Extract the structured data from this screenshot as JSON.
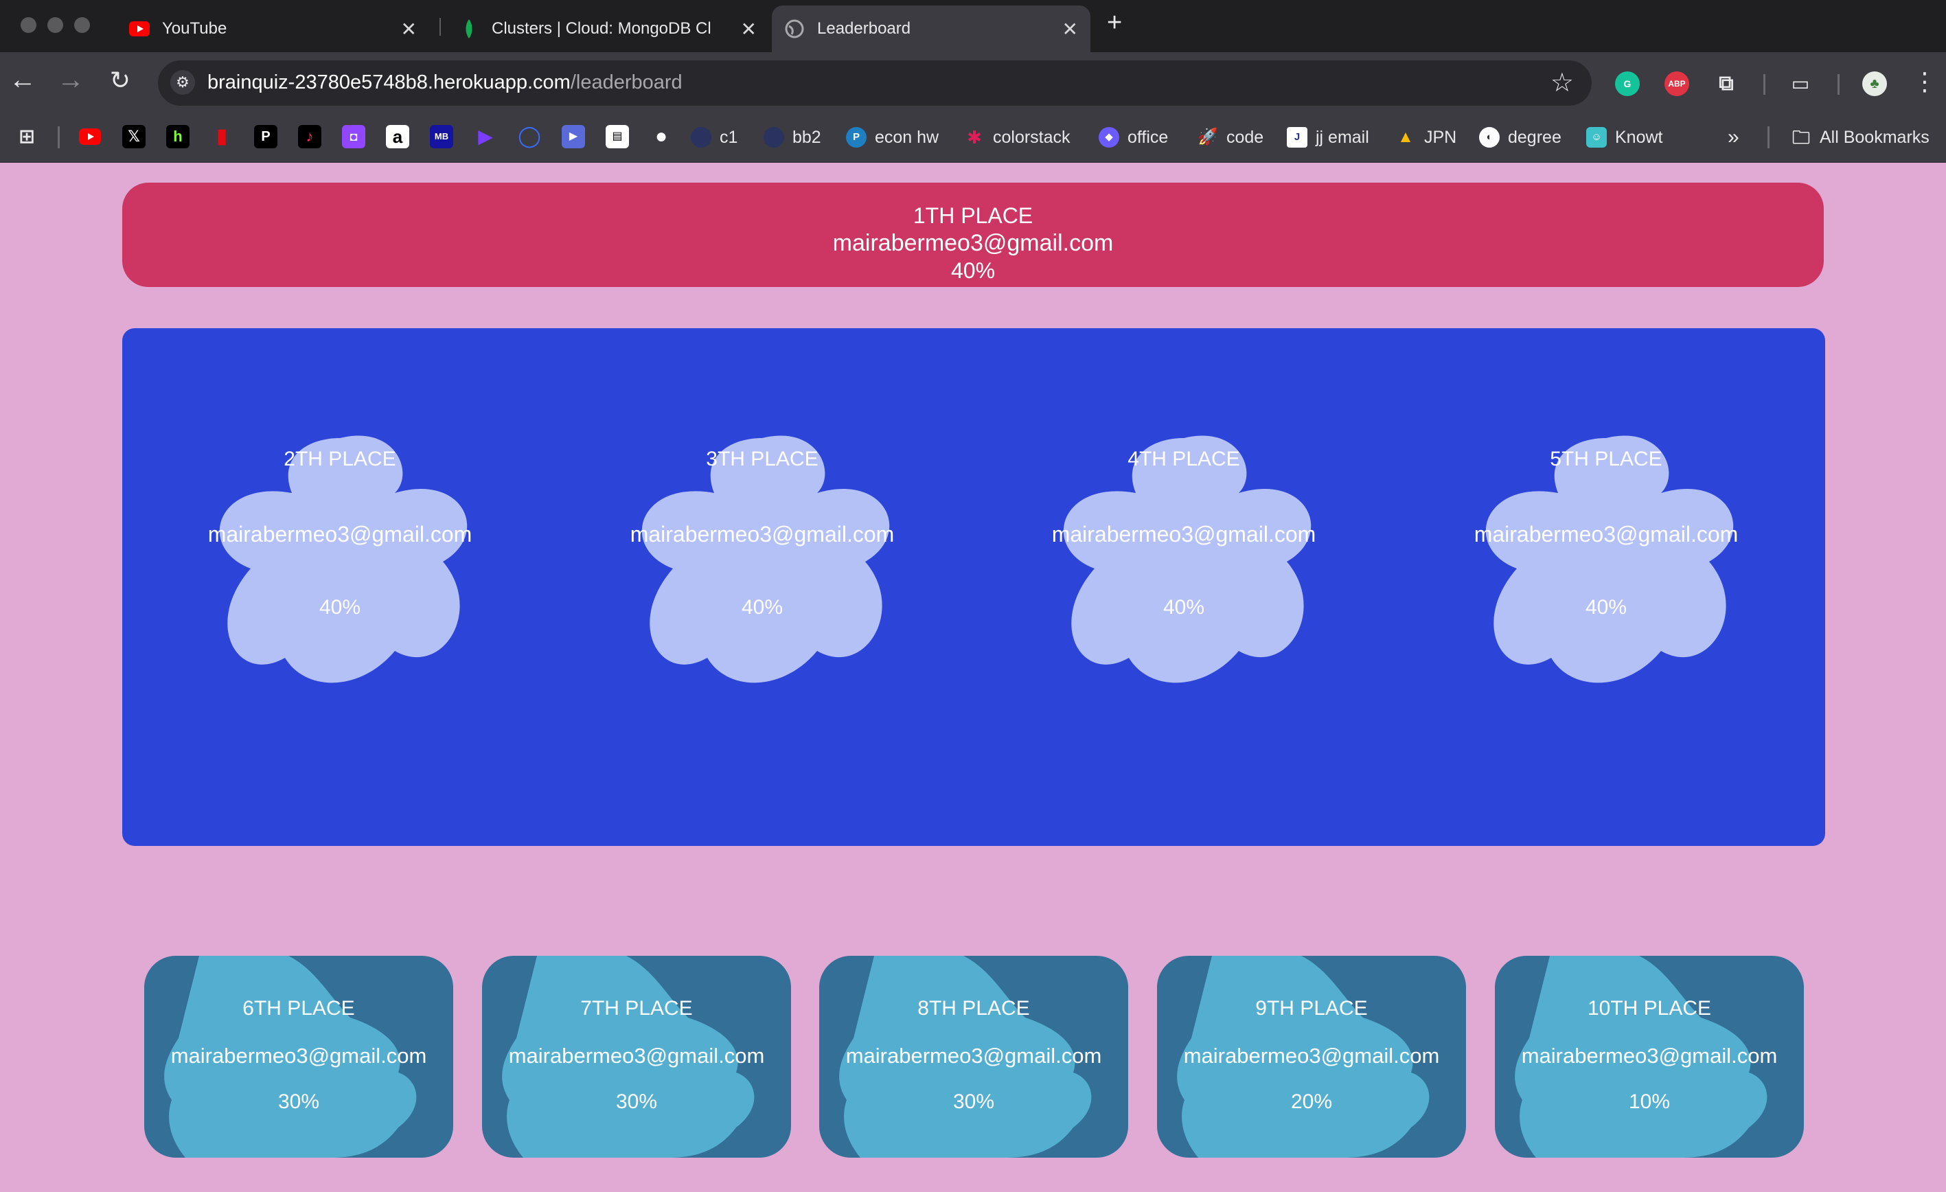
{
  "browser": {
    "tabs": [
      {
        "title": "YouTube",
        "close": "✕"
      },
      {
        "title": "Clusters | Cloud: MongoDB Cl",
        "close": "✕"
      },
      {
        "title": "Leaderboard",
        "close": "✕"
      }
    ],
    "new_tab": "+",
    "url_host": "brainquiz-23780e5748b8.herokuapp.com",
    "url_path": "/leaderboard",
    "bookmarks": [
      {
        "label": "c1"
      },
      {
        "label": "bb2"
      },
      {
        "label": "econ hw"
      },
      {
        "label": "colorstack"
      },
      {
        "label": "office"
      },
      {
        "label": "code"
      },
      {
        "label": "jj email"
      },
      {
        "label": "JPN"
      },
      {
        "label": "degree"
      },
      {
        "label": "Knowt"
      }
    ],
    "bookmark_icon_letters": [
      "h",
      "P",
      "a",
      "MB"
    ],
    "overflow": "»",
    "all_bookmarks": "All Bookmarks",
    "ext_abp": "ABP"
  },
  "leaderboard": {
    "first": {
      "rank": "1TH PLACE",
      "email": "mairabermeo3@gmail.com",
      "score": "40%"
    },
    "top": [
      {
        "rank": "2TH PLACE",
        "email": "mairabermeo3@gmail.com",
        "score": "40%"
      },
      {
        "rank": "3TH PLACE",
        "email": "mairabermeo3@gmail.com",
        "score": "40%"
      },
      {
        "rank": "4TH PLACE",
        "email": "mairabermeo3@gmail.com",
        "score": "40%"
      },
      {
        "rank": "5TH PLACE",
        "email": "mairabermeo3@gmail.com",
        "score": "40%"
      }
    ],
    "rest": [
      {
        "rank": "6TH PLACE",
        "email": "mairabermeo3@gmail.com",
        "score": "30%"
      },
      {
        "rank": "7TH PLACE",
        "email": "mairabermeo3@gmail.com",
        "score": "30%"
      },
      {
        "rank": "8TH PLACE",
        "email": "mairabermeo3@gmail.com",
        "score": "30%"
      },
      {
        "rank": "9TH PLACE",
        "email": "mairabermeo3@gmail.com",
        "score": "20%"
      },
      {
        "rank": "10TH PLACE",
        "email": "mairabermeo3@gmail.com",
        "score": "10%"
      }
    ]
  },
  "colors": {
    "page_bg": "#e0aad4",
    "first_bg": "#cd3562",
    "top_box_bg": "#2c44d8",
    "flower": "#b4c1f7",
    "card_bg": "#336f97",
    "card_blob": "#54aed0"
  }
}
